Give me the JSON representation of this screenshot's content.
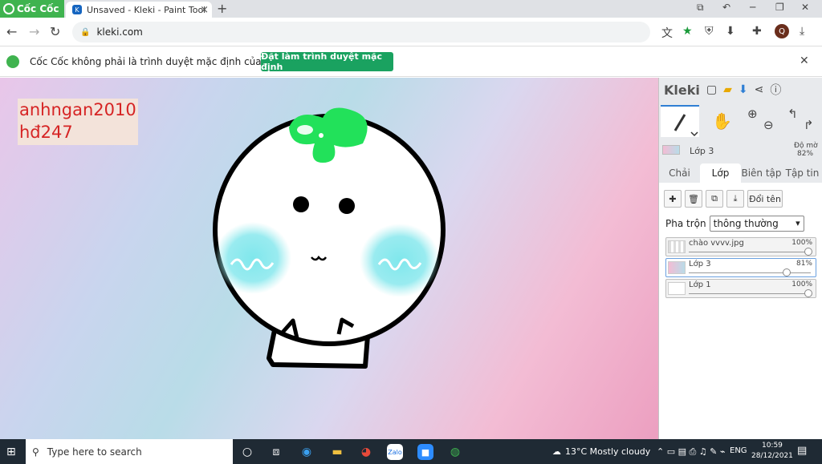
{
  "browser": {
    "brand": "Cốc Cốc",
    "tab": {
      "title": "Unsaved - Kleki - Paint Tool",
      "favicon": "kleki-icon"
    },
    "url": "kleki.com"
  },
  "infobar": {
    "message": "Cốc Cốc không phải là trình duyệt mặc định của bạn",
    "button_label": "Đặt làm trình duyệt mặc định"
  },
  "canvas": {
    "watermark_line1": "anhngan2010",
    "watermark_line2": "hđ247"
  },
  "panel": {
    "app_name": "Kleki",
    "current_layer": "Lớp 3",
    "opacity_label": "Độ mờ",
    "opacity_value": "82%",
    "tabs": [
      "Chải",
      "Lớp",
      "Biên tập",
      "Tập tin"
    ],
    "active_tab": "Lớp",
    "rename_label": "Đổi tên",
    "blend_label": "Pha trộn",
    "blend_value": "thông thường",
    "layers": [
      {
        "name": "chào vvvv.jpg",
        "opacity": "100%",
        "level": 1.0
      },
      {
        "name": "Lớp 3",
        "opacity": "81%",
        "level": 0.81,
        "active": true
      },
      {
        "name": "Lớp 1",
        "opacity": "100%",
        "level": 1.0
      }
    ]
  },
  "taskbar": {
    "search_placeholder": "Type here to search",
    "weather": "13°C  Mostly cloudy",
    "language": "ENG",
    "time": "10:59",
    "date": "28/12/2021"
  },
  "colors": {
    "brand_green": "#3fb34f",
    "infobar_button": "#1aa260",
    "watermark_text": "#d62424",
    "accent_blue": "#2f7fd4"
  }
}
